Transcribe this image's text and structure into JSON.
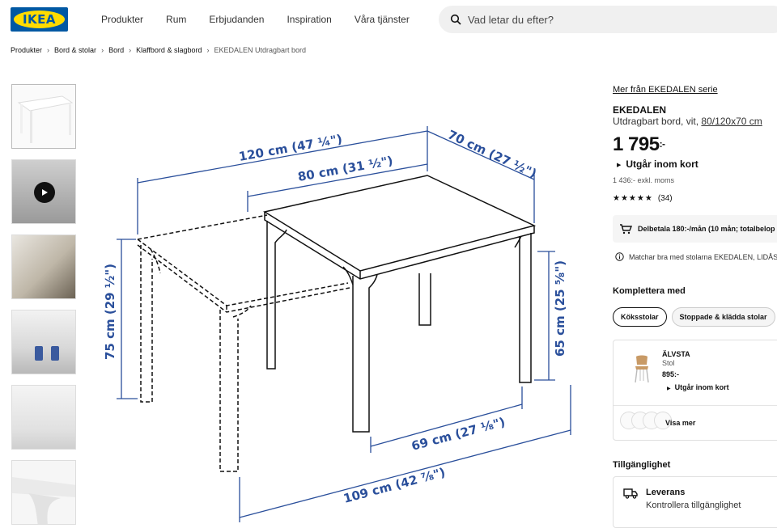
{
  "header": {
    "logo": "IKEA",
    "nav": [
      "Produkter",
      "Rum",
      "Erbjudanden",
      "Inspiration",
      "Våra tjänster"
    ],
    "search_placeholder": "Vad letar du efter?"
  },
  "breadcrumb": [
    "Produkter",
    "Bord & stolar",
    "Bord",
    "Klaffbord & slagbord",
    "EKEDALEN Utdragbart bord"
  ],
  "gallery": {
    "thumbnails": [
      "product-white",
      "video",
      "dining-room",
      "kitchen-blue-chairs",
      "dining-white",
      "detail-corner"
    ]
  },
  "diagram": {
    "dims": {
      "len_ext": "120 cm (47 ¼\")",
      "len": "80 cm (31 ½\")",
      "width": "70 cm (27 ½\")",
      "height": "75 cm (29 ½\")",
      "height_under": "65 cm (25 ⅝\")",
      "inner_w": "69 cm (27 ⅛\")",
      "inner_len": "109 cm (42 ⅞\")"
    }
  },
  "product": {
    "series_link": "Mer från EKEDALEN serie",
    "name": "EKEDALEN",
    "desc_prefix": "Utdragbart bord, vit, ",
    "desc_size": "80/120x70 cm",
    "price_main": "1 795",
    "price_suffix": ":-",
    "stock": "Utgår inom kort",
    "ex_moms": "1 436:- exkl. moms",
    "stars": "★★★★★",
    "rating_value": 4.5,
    "review_count": "(34)",
    "installment": "Delbetala 180:-/mån (10 mån; totalbelop",
    "match": "Matchar bra med stolarna EKEDALEN, LIDÅS, K"
  },
  "complement": {
    "heading": "Komplettera med",
    "chips": [
      "Köksstolar",
      "Stoppade & klädda stolar"
    ],
    "card": {
      "name": "ÄLVSTA",
      "type": "Stol",
      "price": "895:-",
      "stock": "Utgår inom kort",
      "more": "Visa mer"
    }
  },
  "availability": {
    "heading": "Tillgänglighet",
    "delivery_title": "Leverans",
    "delivery_sub": "Kontrollera tillgänglighet"
  },
  "colors": {
    "ikea_blue": "#0058a3",
    "ikea_yellow": "#ffdb00",
    "dimension_blue": "#2a4f9b"
  }
}
